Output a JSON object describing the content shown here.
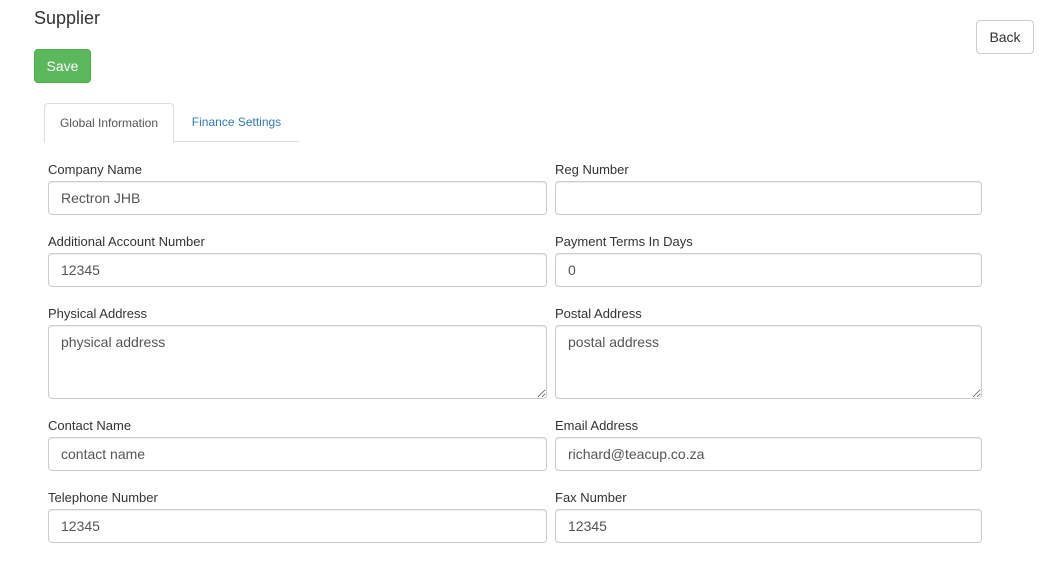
{
  "page": {
    "title": "Supplier"
  },
  "toolbar": {
    "save_label": "Save",
    "back_label": "Back"
  },
  "tabs": [
    {
      "label": "Global Information",
      "active": true
    },
    {
      "label": "Finance Settings",
      "active": false
    }
  ],
  "form": {
    "company_name": {
      "label": "Company Name",
      "value": "Rectron JHB"
    },
    "reg_number": {
      "label": "Reg Number",
      "value": ""
    },
    "additional_account_number": {
      "label": "Additional Account Number",
      "value": "12345"
    },
    "payment_terms": {
      "label": "Payment Terms In Days",
      "value": "0"
    },
    "physical_address": {
      "label": "Physical Address",
      "value": "physical address"
    },
    "postal_address": {
      "label": "Postal Address",
      "value": "postal address"
    },
    "contact_name": {
      "label": "Contact Name",
      "value": "contact name"
    },
    "email_address": {
      "label": "Email Address",
      "value": "richard@teacup.co.za"
    },
    "telephone_number": {
      "label": "Telephone Number",
      "value": "12345"
    },
    "fax_number": {
      "label": "Fax Number",
      "value": "12345"
    }
  },
  "colors": {
    "save_button": "#5cb85c",
    "link": "#337ab7",
    "border": "#cccccc"
  }
}
